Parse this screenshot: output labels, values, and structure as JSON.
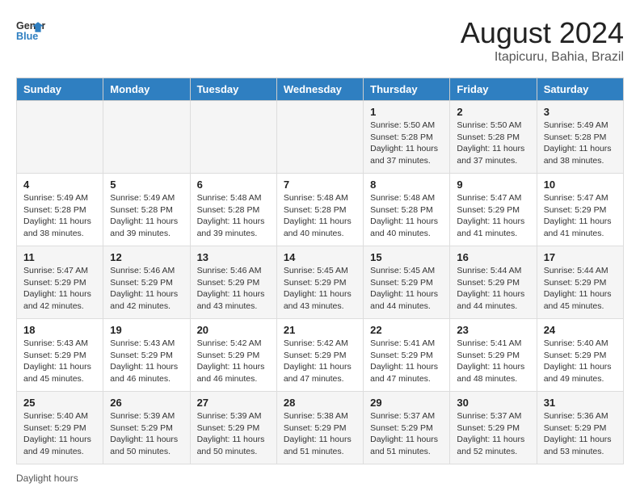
{
  "header": {
    "logo_line1": "General",
    "logo_line2": "Blue",
    "month_title": "August 2024",
    "location": "Itapicuru, Bahia, Brazil"
  },
  "days_of_week": [
    "Sunday",
    "Monday",
    "Tuesday",
    "Wednesday",
    "Thursday",
    "Friday",
    "Saturday"
  ],
  "weeks": [
    [
      {
        "day": "",
        "info": ""
      },
      {
        "day": "",
        "info": ""
      },
      {
        "day": "",
        "info": ""
      },
      {
        "day": "",
        "info": ""
      },
      {
        "day": "1",
        "info": "Sunrise: 5:50 AM\nSunset: 5:28 PM\nDaylight: 11 hours and 37 minutes."
      },
      {
        "day": "2",
        "info": "Sunrise: 5:50 AM\nSunset: 5:28 PM\nDaylight: 11 hours and 37 minutes."
      },
      {
        "day": "3",
        "info": "Sunrise: 5:49 AM\nSunset: 5:28 PM\nDaylight: 11 hours and 38 minutes."
      }
    ],
    [
      {
        "day": "4",
        "info": "Sunrise: 5:49 AM\nSunset: 5:28 PM\nDaylight: 11 hours and 38 minutes."
      },
      {
        "day": "5",
        "info": "Sunrise: 5:49 AM\nSunset: 5:28 PM\nDaylight: 11 hours and 39 minutes."
      },
      {
        "day": "6",
        "info": "Sunrise: 5:48 AM\nSunset: 5:28 PM\nDaylight: 11 hours and 39 minutes."
      },
      {
        "day": "7",
        "info": "Sunrise: 5:48 AM\nSunset: 5:28 PM\nDaylight: 11 hours and 40 minutes."
      },
      {
        "day": "8",
        "info": "Sunrise: 5:48 AM\nSunset: 5:28 PM\nDaylight: 11 hours and 40 minutes."
      },
      {
        "day": "9",
        "info": "Sunrise: 5:47 AM\nSunset: 5:29 PM\nDaylight: 11 hours and 41 minutes."
      },
      {
        "day": "10",
        "info": "Sunrise: 5:47 AM\nSunset: 5:29 PM\nDaylight: 11 hours and 41 minutes."
      }
    ],
    [
      {
        "day": "11",
        "info": "Sunrise: 5:47 AM\nSunset: 5:29 PM\nDaylight: 11 hours and 42 minutes."
      },
      {
        "day": "12",
        "info": "Sunrise: 5:46 AM\nSunset: 5:29 PM\nDaylight: 11 hours and 42 minutes."
      },
      {
        "day": "13",
        "info": "Sunrise: 5:46 AM\nSunset: 5:29 PM\nDaylight: 11 hours and 43 minutes."
      },
      {
        "day": "14",
        "info": "Sunrise: 5:45 AM\nSunset: 5:29 PM\nDaylight: 11 hours and 43 minutes."
      },
      {
        "day": "15",
        "info": "Sunrise: 5:45 AM\nSunset: 5:29 PM\nDaylight: 11 hours and 44 minutes."
      },
      {
        "day": "16",
        "info": "Sunrise: 5:44 AM\nSunset: 5:29 PM\nDaylight: 11 hours and 44 minutes."
      },
      {
        "day": "17",
        "info": "Sunrise: 5:44 AM\nSunset: 5:29 PM\nDaylight: 11 hours and 45 minutes."
      }
    ],
    [
      {
        "day": "18",
        "info": "Sunrise: 5:43 AM\nSunset: 5:29 PM\nDaylight: 11 hours and 45 minutes."
      },
      {
        "day": "19",
        "info": "Sunrise: 5:43 AM\nSunset: 5:29 PM\nDaylight: 11 hours and 46 minutes."
      },
      {
        "day": "20",
        "info": "Sunrise: 5:42 AM\nSunset: 5:29 PM\nDaylight: 11 hours and 46 minutes."
      },
      {
        "day": "21",
        "info": "Sunrise: 5:42 AM\nSunset: 5:29 PM\nDaylight: 11 hours and 47 minutes."
      },
      {
        "day": "22",
        "info": "Sunrise: 5:41 AM\nSunset: 5:29 PM\nDaylight: 11 hours and 47 minutes."
      },
      {
        "day": "23",
        "info": "Sunrise: 5:41 AM\nSunset: 5:29 PM\nDaylight: 11 hours and 48 minutes."
      },
      {
        "day": "24",
        "info": "Sunrise: 5:40 AM\nSunset: 5:29 PM\nDaylight: 11 hours and 49 minutes."
      }
    ],
    [
      {
        "day": "25",
        "info": "Sunrise: 5:40 AM\nSunset: 5:29 PM\nDaylight: 11 hours and 49 minutes."
      },
      {
        "day": "26",
        "info": "Sunrise: 5:39 AM\nSunset: 5:29 PM\nDaylight: 11 hours and 50 minutes."
      },
      {
        "day": "27",
        "info": "Sunrise: 5:39 AM\nSunset: 5:29 PM\nDaylight: 11 hours and 50 minutes."
      },
      {
        "day": "28",
        "info": "Sunrise: 5:38 AM\nSunset: 5:29 PM\nDaylight: 11 hours and 51 minutes."
      },
      {
        "day": "29",
        "info": "Sunrise: 5:37 AM\nSunset: 5:29 PM\nDaylight: 11 hours and 51 minutes."
      },
      {
        "day": "30",
        "info": "Sunrise: 5:37 AM\nSunset: 5:29 PM\nDaylight: 11 hours and 52 minutes."
      },
      {
        "day": "31",
        "info": "Sunrise: 5:36 AM\nSunset: 5:29 PM\nDaylight: 11 hours and 53 minutes."
      }
    ]
  ],
  "footer": {
    "note": "Daylight hours"
  }
}
